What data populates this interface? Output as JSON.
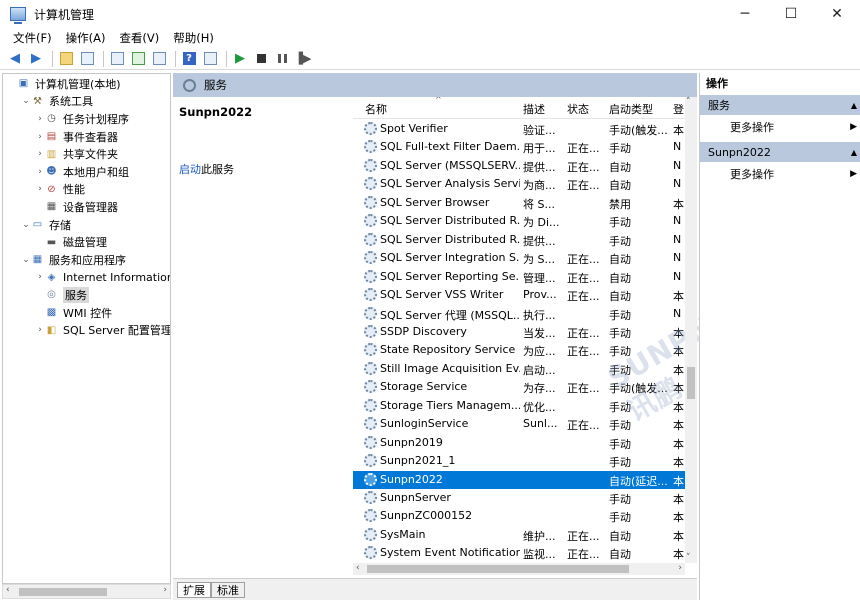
{
  "window": {
    "title": "计算机管理",
    "buttons": {
      "minimize": "─",
      "maximize": "☐",
      "close": "✕"
    }
  },
  "menu": [
    "文件(F)",
    "操作(A)",
    "查看(V)",
    "帮助(H)"
  ],
  "tree": {
    "items": [
      {
        "label": "计算机管理(本地)",
        "level": 0,
        "chev": "",
        "icon": "computer-icon"
      },
      {
        "label": "系统工具",
        "level": 1,
        "chev": "⌄",
        "icon": "tools-icon"
      },
      {
        "label": "任务计划程序",
        "level": 2,
        "chev": "›",
        "icon": "clock-icon"
      },
      {
        "label": "事件查看器",
        "level": 2,
        "chev": "›",
        "icon": "event-viewer-icon"
      },
      {
        "label": "共享文件夹",
        "level": 2,
        "chev": "›",
        "icon": "shared-folder-icon"
      },
      {
        "label": "本地用户和组",
        "level": 2,
        "chev": "›",
        "icon": "users-icon"
      },
      {
        "label": "性能",
        "level": 2,
        "chev": "›",
        "icon": "performance-icon"
      },
      {
        "label": "设备管理器",
        "level": 2,
        "chev": "",
        "icon": "device-manager-icon"
      },
      {
        "label": "存储",
        "level": 1,
        "chev": "⌄",
        "icon": "storage-icon"
      },
      {
        "label": "磁盘管理",
        "level": 2,
        "chev": "",
        "icon": "disk-icon"
      },
      {
        "label": "服务和应用程序",
        "level": 1,
        "chev": "⌄",
        "icon": "services-apps-icon"
      },
      {
        "label": "Internet Information S",
        "level": 2,
        "chev": "›",
        "icon": "iis-icon"
      },
      {
        "label": "服务",
        "level": 2,
        "chev": "",
        "icon": "services-icon",
        "selected": true
      },
      {
        "label": "WMI 控件",
        "level": 2,
        "chev": "",
        "icon": "wmi-icon"
      },
      {
        "label": "SQL Server 配置管理器",
        "level": 2,
        "chev": "›",
        "icon": "sql-config-icon"
      }
    ],
    "scroll_left": "‹",
    "scroll_right": "›"
  },
  "center": {
    "header": "服务",
    "detail_title": "Sunpn2022",
    "detail_link": "启动",
    "detail_link_suffix": "此服务",
    "columns": {
      "name": "名称",
      "desc": "描述",
      "status": "状态",
      "startup": "启动类型",
      "logon": "登"
    },
    "sort_arrow": "^",
    "services": [
      {
        "name": "Spot Verifier",
        "desc": "验证...",
        "status": "",
        "startup": "手动(触发...",
        "logon": "本"
      },
      {
        "name": "SQL Full-text Filter Daem...",
        "desc": "用于...",
        "status": "正在...",
        "startup": "手动",
        "logon": "N"
      },
      {
        "name": "SQL Server (MSSQLSERV...",
        "desc": "提供...",
        "status": "正在...",
        "startup": "自动",
        "logon": "N"
      },
      {
        "name": "SQL Server Analysis Servi...",
        "desc": "为商...",
        "status": "正在...",
        "startup": "自动",
        "logon": "N"
      },
      {
        "name": "SQL Server Browser",
        "desc": "将 S...",
        "status": "",
        "startup": "禁用",
        "logon": "本"
      },
      {
        "name": "SQL Server Distributed R...",
        "desc": "为 Di...",
        "status": "",
        "startup": "手动",
        "logon": "N"
      },
      {
        "name": "SQL Server Distributed R...",
        "desc": "提供...",
        "status": "",
        "startup": "手动",
        "logon": "N"
      },
      {
        "name": "SQL Server Integration S...",
        "desc": "为 S...",
        "status": "正在...",
        "startup": "自动",
        "logon": "N"
      },
      {
        "name": "SQL Server Reporting Se...",
        "desc": "管理...",
        "status": "正在...",
        "startup": "自动",
        "logon": "N"
      },
      {
        "name": "SQL Server VSS Writer",
        "desc": "Prov...",
        "status": "正在...",
        "startup": "自动",
        "logon": "本"
      },
      {
        "name": "SQL Server 代理 (MSSQL...",
        "desc": "执行...",
        "status": "",
        "startup": "手动",
        "logon": "N"
      },
      {
        "name": "SSDP Discovery",
        "desc": "当发...",
        "status": "正在...",
        "startup": "手动",
        "logon": "本"
      },
      {
        "name": "State Repository Service",
        "desc": "为应...",
        "status": "正在...",
        "startup": "手动",
        "logon": "本"
      },
      {
        "name": "Still Image Acquisition Ev...",
        "desc": "启动...",
        "status": "",
        "startup": "手动",
        "logon": "本"
      },
      {
        "name": "Storage Service",
        "desc": "为存...",
        "status": "正在...",
        "startup": "手动(触发...",
        "logon": "本"
      },
      {
        "name": "Storage Tiers Managem...",
        "desc": "优化...",
        "status": "",
        "startup": "手动",
        "logon": "本"
      },
      {
        "name": "SunloginService",
        "desc": "Sunl...",
        "status": "正在...",
        "startup": "手动",
        "logon": "本"
      },
      {
        "name": "Sunpn2019",
        "desc": "",
        "status": "",
        "startup": "手动",
        "logon": "本"
      },
      {
        "name": "Sunpn2021_1",
        "desc": "",
        "status": "",
        "startup": "手动",
        "logon": "本"
      },
      {
        "name": "Sunpn2022",
        "desc": "",
        "status": "",
        "startup": "自动(延迟...",
        "logon": "本",
        "selected": true
      },
      {
        "name": "SunpnServer",
        "desc": "",
        "status": "",
        "startup": "手动",
        "logon": "本"
      },
      {
        "name": "SunpnZC000152",
        "desc": "",
        "status": "",
        "startup": "手动",
        "logon": "本"
      },
      {
        "name": "SysMain",
        "desc": "维护...",
        "status": "正在...",
        "startup": "自动",
        "logon": "本"
      },
      {
        "name": "System Event Notification...",
        "desc": "监视...",
        "status": "正在...",
        "startup": "自动",
        "logon": "本"
      }
    ],
    "tabs": [
      "扩展",
      "标准"
    ],
    "watermark": "SUNPN讯鹏",
    "scroll_up": "˄",
    "scroll_down": "˅",
    "scroll_left": "‹",
    "scroll_right": "›"
  },
  "actions": {
    "title": "操作",
    "sections": [
      {
        "label": "服务",
        "collapse": "▲",
        "item": "更多操作",
        "arrow": "▶"
      },
      {
        "label": "Sunpn2022",
        "collapse": "▲",
        "item": "更多操作",
        "arrow": "▶"
      }
    ]
  },
  "colors": {
    "selection": "#0078d7",
    "header_band": "#b9c8dc",
    "link": "#1b59c4"
  }
}
